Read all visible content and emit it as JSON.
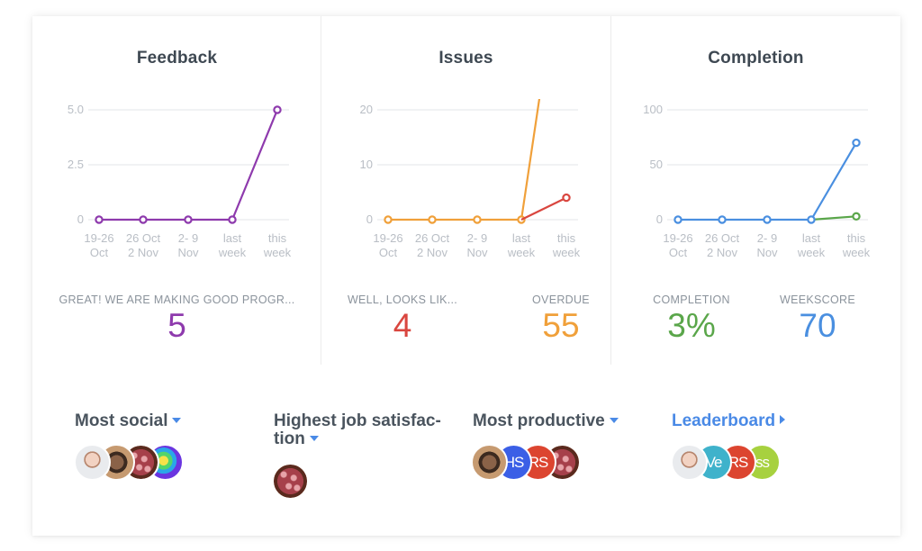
{
  "panels": [
    {
      "title": "Feedback",
      "stats": [
        {
          "label": "GREAT! WE ARE MAKING GOOD PROGR...",
          "value": "5",
          "color": "#8e3aad"
        }
      ]
    },
    {
      "title": "Issues",
      "stats": [
        {
          "label": "WELL, LOOKS LIK...",
          "value": "4",
          "color": "#d9463f"
        },
        {
          "label": "OVERDUE",
          "value": "55",
          "color": "#f0a03a"
        }
      ]
    },
    {
      "title": "Completion",
      "stats": [
        {
          "label": "COMPLETION",
          "value": "3%",
          "color": "#5aa64a"
        },
        {
          "label": "WEEKSCORE",
          "value": "70",
          "color": "#4a8fe0"
        }
      ]
    }
  ],
  "chart_data": [
    {
      "type": "line",
      "title": "Feedback",
      "categories": [
        "19-26 Oct",
        "26 Oct 2 Nov",
        "2- 9 Nov",
        "last week",
        "this week"
      ],
      "category_lines": [
        [
          "19-26",
          "Oct"
        ],
        [
          "26 Oct",
          "2 Nov"
        ],
        [
          "2- 9",
          "Nov"
        ],
        [
          "last",
          "week"
        ],
        [
          "this",
          "week"
        ]
      ],
      "yticks": [
        "0",
        "2.5",
        "5.0"
      ],
      "ytick_values": [
        0,
        2.5,
        5
      ],
      "ylim": [
        0,
        5
      ],
      "grid": true,
      "series": [
        {
          "name": "Feedback",
          "color": "#8e3aad",
          "values": [
            0,
            0,
            0,
            0,
            5
          ],
          "markers": [
            true,
            true,
            true,
            true,
            true
          ]
        }
      ]
    },
    {
      "type": "line",
      "title": "Issues",
      "categories": [
        "19-26 Oct",
        "26 Oct 2 Nov",
        "2- 9 Nov",
        "last week",
        "this week"
      ],
      "category_lines": [
        [
          "19-26",
          "Oct"
        ],
        [
          "26 Oct",
          "2 Nov"
        ],
        [
          "2- 9",
          "Nov"
        ],
        [
          "last",
          "week"
        ],
        [
          "this",
          "week"
        ]
      ],
      "yticks": [
        "0",
        "10",
        "20"
      ],
      "ytick_values": [
        0,
        10,
        20
      ],
      "ylim": [
        0,
        20
      ],
      "grid": true,
      "series": [
        {
          "name": "Overdue",
          "color": "#f0a03a",
          "values": [
            0,
            0,
            0,
            0,
            55
          ],
          "markers": [
            true,
            true,
            true,
            true,
            false
          ]
        },
        {
          "name": "Issues",
          "color": "#d9463f",
          "values": [
            null,
            null,
            null,
            0,
            4
          ],
          "markers": [
            false,
            false,
            false,
            false,
            true
          ]
        }
      ]
    },
    {
      "type": "line",
      "title": "Completion",
      "categories": [
        "19-26 Oct",
        "26 Oct 2 Nov",
        "2- 9 Nov",
        "last week",
        "this week"
      ],
      "category_lines": [
        [
          "19-26",
          "Oct"
        ],
        [
          "26 Oct",
          "2 Nov"
        ],
        [
          "2- 9",
          "Nov"
        ],
        [
          "last",
          "week"
        ],
        [
          "this",
          "week"
        ]
      ],
      "yticks": [
        "0",
        "50",
        "100"
      ],
      "ytick_values": [
        0,
        50,
        100
      ],
      "ylim": [
        0,
        100
      ],
      "grid": true,
      "series": [
        {
          "name": "Completion",
          "color": "#5aa64a",
          "values": [
            null,
            null,
            null,
            0,
            3
          ],
          "markers": [
            false,
            false,
            false,
            false,
            true
          ]
        },
        {
          "name": "Weekscore",
          "color": "#4a8fe0",
          "values": [
            0,
            0,
            0,
            0,
            70
          ],
          "markers": [
            true,
            true,
            true,
            true,
            true
          ]
        }
      ]
    }
  ],
  "sections": [
    {
      "title": "Most social",
      "caret": "dropdown",
      "avatars": [
        {
          "type": "photo",
          "style": "face-light",
          "initials": ""
        },
        {
          "type": "photo",
          "style": "face-dark",
          "initials": ""
        },
        {
          "type": "photo",
          "style": "virus",
          "initials": ""
        },
        {
          "type": "photo",
          "style": "thermal",
          "initials": ""
        }
      ]
    },
    {
      "title_line1": "Highest job satisfac-",
      "title_line2": "tion",
      "caret": "dropdown",
      "avatars": [
        {
          "type": "photo",
          "style": "virus",
          "initials": ""
        }
      ]
    },
    {
      "title": "Most productive",
      "caret": "dropdown",
      "avatars": [
        {
          "type": "photo",
          "style": "face-dark",
          "initials": ""
        },
        {
          "type": "initials",
          "style": "hs",
          "initials": "HS"
        },
        {
          "type": "initials",
          "style": "rs",
          "initials": "RS"
        },
        {
          "type": "photo",
          "style": "virus",
          "initials": ""
        }
      ]
    },
    {
      "title": "Leaderboard",
      "caret": "link",
      "avatars": [
        {
          "type": "photo",
          "style": "face-light",
          "initials": ""
        },
        {
          "type": "initials",
          "style": "ve",
          "initials": "Ve"
        },
        {
          "type": "initials",
          "style": "rs",
          "initials": "RS"
        },
        {
          "type": "initials",
          "style": "ss",
          "initials": "ss"
        }
      ]
    }
  ]
}
